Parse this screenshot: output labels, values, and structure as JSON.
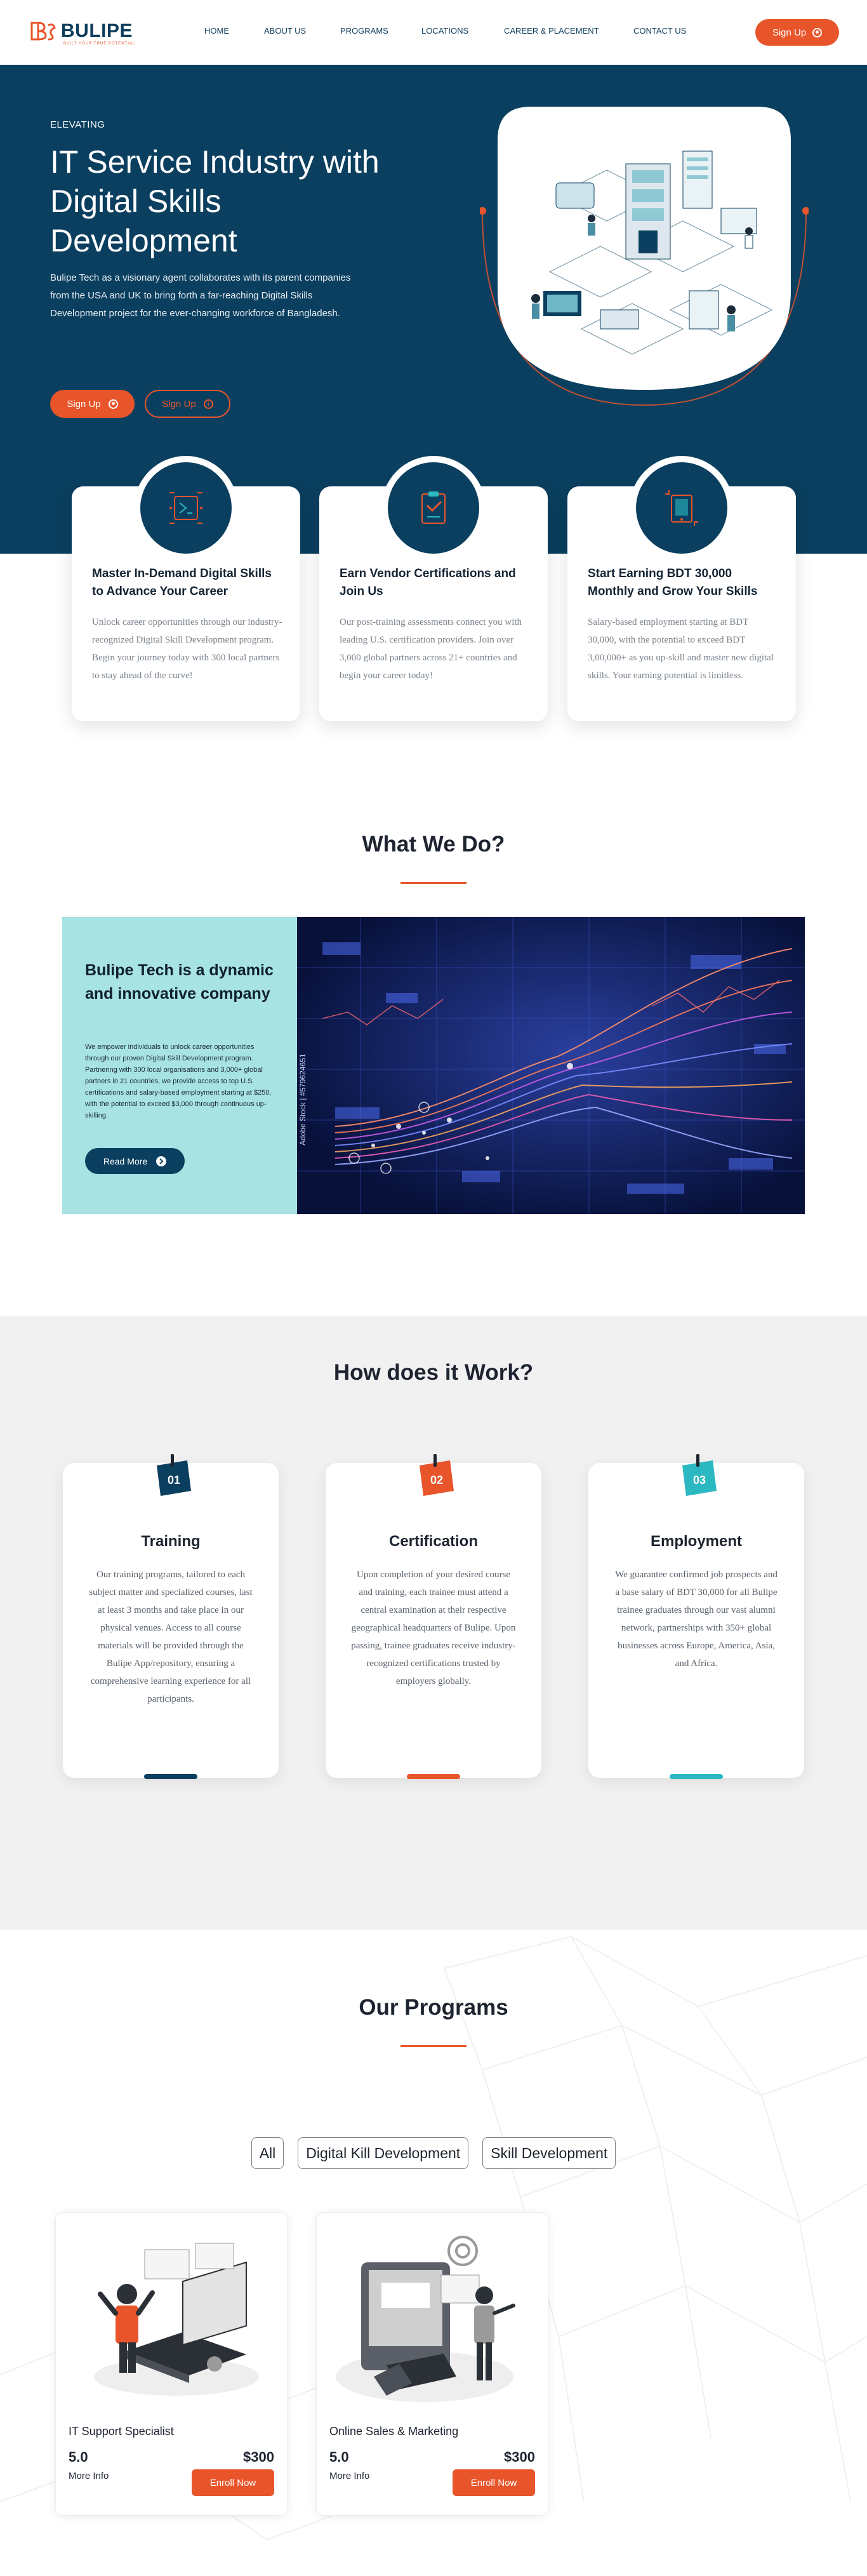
{
  "brand": {
    "name": "BULIPE",
    "tagline": "BUILT YOUR TRUE POTENTIAL",
    "accent": "#e8552b",
    "navy": "#0b3f5f",
    "teal": "#a6e3e2"
  },
  "nav": {
    "items": [
      "HOME",
      "ABOUT US",
      "PROGRAMS",
      "LOCATIONS",
      "CAREER & PLACEMENT",
      "CONTACT US"
    ],
    "signup_label": "Sign Up"
  },
  "hero": {
    "eyebrow": "ELEVATING",
    "title": "IT Service Industry with Digital Skills Development",
    "description": "Bulipe Tech as a visionary agent collaborates with its parent companies from the USA and UK to bring forth a far-reaching Digital Skills Development project for the ever-changing workforce of Bangladesh.",
    "primary_label": "Sign Up",
    "secondary_label": "Sign Up"
  },
  "features": [
    {
      "icon": "skills-icon",
      "title": "Master In-Demand Digital Skills to Advance Your Career",
      "text": "Unlock career opportunities through our industry-recognized Digital Skill Development program. Begin your journey today with 300 local partners to stay ahead of the curve!"
    },
    {
      "icon": "certificate-icon",
      "title": "Earn Vendor Certifications and Join Us",
      "text": "Our post-training assessments connect you with leading U.S. certification providers. Join over 3,000 global partners across 21+ countries and begin your career today!"
    },
    {
      "icon": "earning-icon",
      "title": "Start Earning BDT 30,000 Monthly and Grow Your Skills",
      "text": "Salary-based employment starting at BDT 30,000, with the potential to exceed BDT 3,00,000+ as you up-skill and master new digital skills. Your earning potential is limitless."
    }
  ],
  "what_we_do": {
    "title": "What We Do?",
    "heading": "Bulipe Tech is a dynamic and innovative company",
    "text": "We empower individuals to unlock career opportunities through our proven Digital Skill Development program. Partnering with 300 local organisations and 3,000+ global partners in 21 countries, we provide access to top U.S. certifications and salary-based employment starting at $250, with the potential to exceed $3,000 through continuous up-skilling.",
    "button_label": "Read More",
    "image_watermark": "Adobe Stock | #579624651"
  },
  "how": {
    "title": "How does it Work?",
    "steps": [
      {
        "number": "01",
        "color": "#0b3f5f",
        "title": "Training",
        "text": "Our training programs, tailored to each subject matter and specialized courses, last at least 3 months and take place in our physical venues. Access to all course materials will be provided through the Bulipe App/repository, ensuring a comprehensive learning experience for all participants."
      },
      {
        "number": "02",
        "color": "#e8552b",
        "title": "Certification",
        "text": "Upon completion of your desired course and training, each trainee must attend a central examination at their respective geographical headquarters of Bulipe. Upon passing, trainee graduates receive industry-recognized certifications trusted by employers globally."
      },
      {
        "number": "03",
        "color": "#2cb8c1",
        "title": "Employment",
        "text": "We guarantee confirmed job prospects and a base salary of BDT 30,000 for all Bulipe trainee graduates through our vast alumni network, partnerships with 350+ global businesses across Europe, America, Asia, and Africa."
      }
    ]
  },
  "programs": {
    "title": "Our Programs",
    "tabs": [
      "All",
      "Digital Kill Development",
      "Skill Development"
    ],
    "items": [
      {
        "name": "IT Support Specialist",
        "rating": "5.0",
        "price": "$300",
        "more": "More Info",
        "button": "Enroll Now"
      },
      {
        "name": "Online Sales & Marketing",
        "rating": "5.0",
        "price": "$300",
        "more": "More Info",
        "button": "Enroll Now"
      }
    ]
  }
}
